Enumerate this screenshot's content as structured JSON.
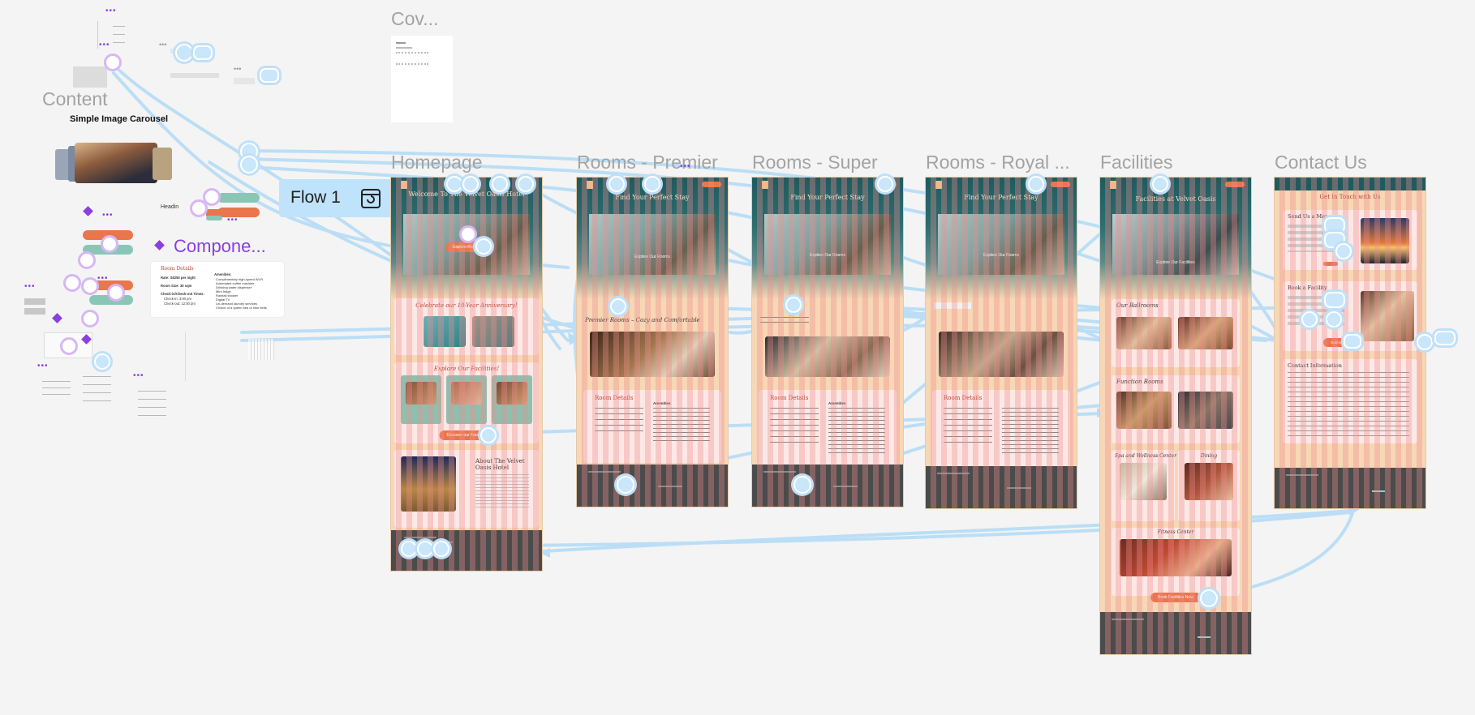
{
  "canvas": {
    "background": "#f4f4f4",
    "accent_link": "#b9ddf7",
    "component_purple": "#8a3fe0",
    "frame_peach": "#f7d7b5",
    "hero_teal": "#1f5a5e",
    "button_orange": "#e9764c",
    "footer_gray": "#4b4b4b"
  },
  "labels": {
    "cover": "Cov...",
    "content": "Content",
    "carousel": "Simple Image Carousel",
    "components": "Compone...",
    "flow": "Flow 1",
    "heading": "Headin"
  },
  "frames": [
    {
      "key": "homepage",
      "label": "Homepage",
      "hero_title": "Welcome To The Velvet Oasis Hotel",
      "hero_button": "Explore Rooms",
      "section1_title": "Celebrate our 10-Year Anniversary!",
      "section2_title": "Explore Our Facilities!",
      "section2_button": "Discover our Facilities",
      "about_title": "About The Velvet Oasis Hotel"
    },
    {
      "key": "rooms_premier",
      "label": "Rooms - Premier",
      "hero_title": "Find Your Perfect Stay",
      "hero_button": "Explore Our Rooms",
      "section_title": "Premier Rooms – Cozy and Comfortable",
      "details_title": "Room Details",
      "amenities": "Amenities"
    },
    {
      "key": "rooms_super",
      "label": "Rooms - Super",
      "hero_title": "Find Your Perfect Stay",
      "hero_button": "Explore Our Rooms",
      "details_title": "Room Details",
      "amenities": "Amenities"
    },
    {
      "key": "rooms_royal",
      "label": "Rooms - Royal ...",
      "hero_title": "Find Your Perfect Stay",
      "hero_button": "Explore Our Rooms",
      "details_title": "Room Details"
    },
    {
      "key": "facilities",
      "label": "Facilities",
      "hero_title": "Facilities at Velvet Oasis",
      "hero_button": "Explore Our Facilities",
      "ballrooms": "Our Ballrooms",
      "function_rooms": "Function Rooms",
      "spa": "Spa and Wellness Center",
      "dining": "Dining",
      "fitness": "Fitness Center",
      "book_button": "Book Facilities Now"
    },
    {
      "key": "contact",
      "label": "Contact Us",
      "hero_title": "Get In Touch with Us",
      "send_message": "Send Us a Message",
      "book_facility": "Book a Facility",
      "contact_info": "Contact Information",
      "submit": "Submit"
    }
  ],
  "room_details_card": {
    "title": "Room Details",
    "rate": "Rate: S$250 per night",
    "size": "Room Size: 30 sqm",
    "checkin_title": "Check-in/Check-out Times:",
    "checkin": "Check-in: 3:00 pm",
    "checkout": "Check-out: 12:00 pm",
    "amenities_title": "Amenities:",
    "amenities": [
      "Complimentary high-speed Wi-Fi",
      "Automated coffee machine",
      "Drinking water dispenser",
      "Mini-fridge",
      "Rainfall shower",
      "Digital TV",
      "Un-demand laundry services",
      "Choice of a queen bed or twin beds"
    ]
  }
}
